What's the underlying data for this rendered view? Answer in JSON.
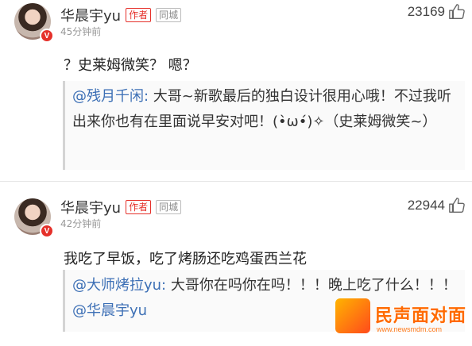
{
  "comments": [
    {
      "username": "华晨宇yu",
      "author_tag": "作者",
      "city_tag": "同城",
      "time": "45分钟前",
      "likes": "23169",
      "text": "？史莱姆微笑？ 嗯？",
      "quote": {
        "mention": "@残月千闲:",
        "text": " 大哥~新歌最后的独白设计很用心哦！不过我听出来你也有在里面说早安对吧！(•̀ω•́)✧（史莱姆微笑~）"
      },
      "badge": "V"
    },
    {
      "username": "华晨宇yu",
      "author_tag": "作者",
      "city_tag": "同城",
      "time": "42分钟前",
      "likes": "22944",
      "text": "我吃了早饭，吃了烤肠还吃鸡蛋西兰花",
      "quote": {
        "mention": "@大师烤拉yu:",
        "text": " 大哥你在吗你在吗！！！晚上吃了什么！！！",
        "mention2": "@华晨宇yu"
      },
      "badge": "V"
    }
  ],
  "watermark": {
    "text": "民声面对面",
    "url": "www.newsmdm.com"
  },
  "colors": {
    "accent": "#e5302a",
    "mention": "#3c6fb5"
  }
}
